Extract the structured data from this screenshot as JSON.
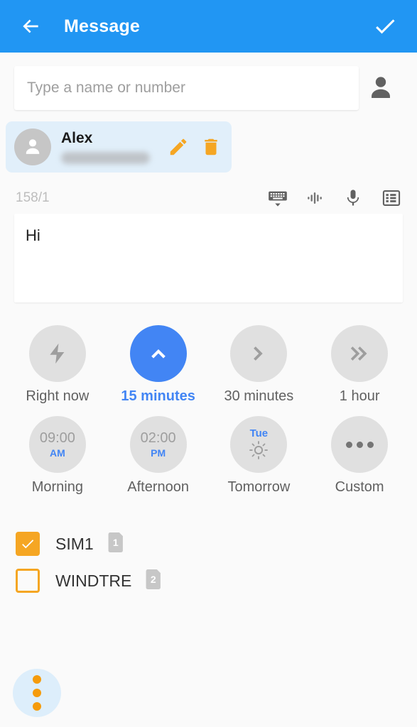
{
  "theme": {
    "header_blue": "#2196f3",
    "accent_blue": "#4285f4",
    "accent_orange": "#f5a623",
    "chip_bg": "#e1effa",
    "circle_gray": "#e0e0e0",
    "page_bg": "#fafafa"
  },
  "header": {
    "back_icon": "arrow-left-icon",
    "title": "Message",
    "done_icon": "check-icon"
  },
  "recipient": {
    "search_placeholder": "Type a name or number",
    "search_value": "",
    "contacts_icon": "person-icon",
    "chip": {
      "avatar_icon": "person-avatar-icon",
      "name": "Alex",
      "number": "",
      "number_redacted": true,
      "edit_icon": "pencil-icon",
      "delete_icon": "trash-icon"
    }
  },
  "compose": {
    "char_counter": "158/1",
    "tools": [
      {
        "name": "keyboard-hide-icon",
        "label": "Hide keyboard"
      },
      {
        "name": "voice-waveform-icon",
        "label": "Assistant"
      },
      {
        "name": "microphone-icon",
        "label": "Voice input"
      },
      {
        "name": "templates-list-icon",
        "label": "Templates"
      }
    ],
    "message_text": "Hi",
    "message_placeholder": ""
  },
  "schedule": {
    "selected_index": 1,
    "options": [
      {
        "label": "Right now",
        "icon": "lightning-bolt-icon",
        "selected": false
      },
      {
        "label": "15 minutes",
        "icon": "chevron-up-icon",
        "selected": true
      },
      {
        "label": "30 minutes",
        "icon": "chevron-right-icon",
        "selected": false
      },
      {
        "label": "1 hour",
        "icon": "double-chevron-icon",
        "selected": false
      },
      {
        "label": "Morning",
        "icon": "clock-time-icon",
        "time": "09:00",
        "meridiem": "AM",
        "selected": false
      },
      {
        "label": "Afternoon",
        "icon": "clock-time-icon",
        "time": "02:00",
        "meridiem": "PM",
        "selected": false
      },
      {
        "label": "Tomorrow",
        "icon": "sun-icon",
        "day": "Tue",
        "selected": false
      },
      {
        "label": "Custom",
        "icon": "ellipsis-icon",
        "selected": false
      }
    ]
  },
  "sims": [
    {
      "label": "SIM1",
      "badge": "1",
      "checked": true
    },
    {
      "label": "WINDTRE",
      "badge": "2",
      "checked": false
    }
  ],
  "fab": {
    "icon": "overflow-menu-icon",
    "label": "More options"
  }
}
